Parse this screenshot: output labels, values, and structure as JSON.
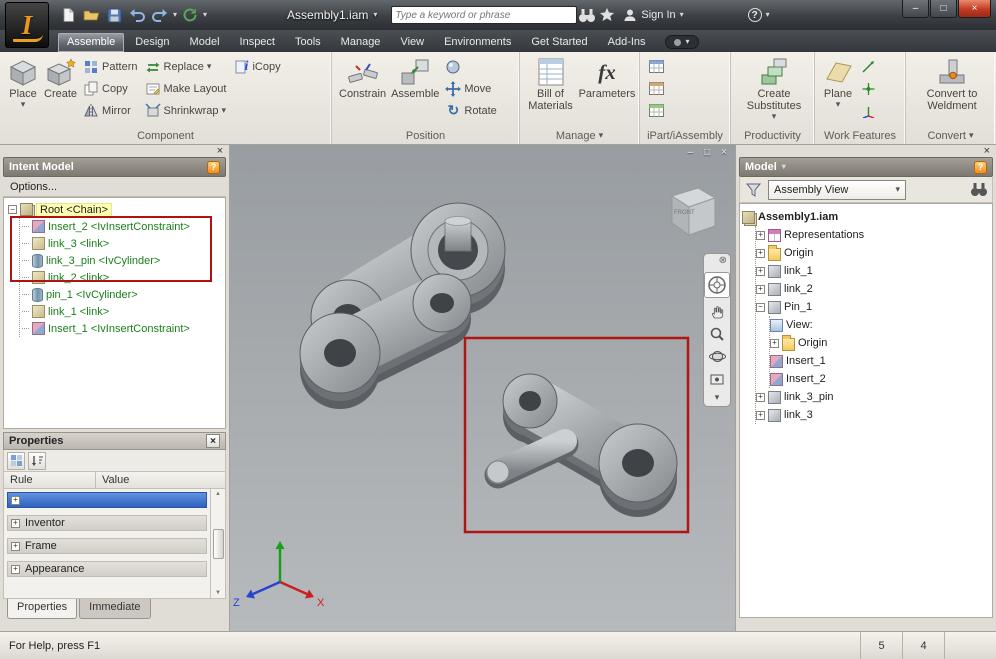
{
  "icons": {
    "dropdown": "▾",
    "close": "×",
    "minimize": "–",
    "maximize": "□",
    "help": "?",
    "plus": "+",
    "minus": "−",
    "up": "▲",
    "down": "▼",
    "rotate": "↻",
    "fx": "fx",
    "nav_close": "⊗",
    "logo": "I",
    "i_glyph": "i"
  },
  "titlebar": {
    "title": "Ass​embly1.iam",
    "search_placeholder": "Type a keyword or phrase",
    "sign_in": "Sign In"
  },
  "tabs": {
    "items": [
      {
        "label": "Assemble"
      },
      {
        "label": "Design"
      },
      {
        "label": "Model"
      },
      {
        "label": "Inspect"
      },
      {
        "label": "Tools"
      },
      {
        "label": "Manage"
      },
      {
        "label": "View"
      },
      {
        "label": "Environments"
      },
      {
        "label": "Get Started"
      },
      {
        "label": "Add-Ins"
      }
    ]
  },
  "ribbon": {
    "component": {
      "label": "Component",
      "place": "Place",
      "create": "Create",
      "pattern": "Pattern",
      "copy": "Copy",
      "mirror": "Mirror",
      "replace": "Replace",
      "make_layout": "Make Layout",
      "shrinkwrap": "Shrinkwrap",
      "icopy": "iCopy"
    },
    "position": {
      "label": "Position",
      "constrain": "Constrain",
      "assemble": "Assemble",
      "move": "Move",
      "rotate": "Rotate"
    },
    "manage": {
      "label": "Manage",
      "bom": "Bill of Materials",
      "parameters": "Parameters"
    },
    "ipart": {
      "label": "iPart/iAssembly"
    },
    "productivity": {
      "label": "Productivity",
      "create_substitutes": "Create Substitutes"
    },
    "work_features": {
      "label": "Work Features",
      "plane": "Plane"
    },
    "convert": {
      "label": "Convert",
      "convert_to_weldment": "Convert to Weldment"
    }
  },
  "intent_model": {
    "title": "Intent Model",
    "options": "Options...",
    "items": [
      {
        "label": "Root <Chain>"
      },
      {
        "label": "Insert_2 <IvInsertConstraint>"
      },
      {
        "label": "link_3 <link>"
      },
      {
        "label": "link_3_pin <IvCylinder>"
      },
      {
        "label": "link_2 <link>"
      },
      {
        "label": "pin_1 <IvCylinder>"
      },
      {
        "label": "link_1 <link>"
      },
      {
        "label": "Insert_1 <IvInsertConstraint>"
      }
    ]
  },
  "properties": {
    "title": "Properties",
    "col_rule": "Rule",
    "col_value": "Value",
    "rows": [
      {
        "label": "Inventor"
      },
      {
        "label": "Frame"
      },
      {
        "label": "Appearance"
      }
    ],
    "tab_properties": "Properties",
    "tab_immediate": "Immediate"
  },
  "viewport": {
    "viewcube_front": "FRONT",
    "axis_x": "X",
    "axis_z": "Z"
  },
  "model_browser": {
    "title": "Model",
    "view_mode": "Assembly View",
    "items": [
      {
        "label": "Assembly1.iam"
      },
      {
        "label": "Representations"
      },
      {
        "label": "Origin"
      },
      {
        "label": "link_1"
      },
      {
        "label": "link_2"
      },
      {
        "label": "Pin_1"
      },
      {
        "label": "View:"
      },
      {
        "label": "Origin"
      },
      {
        "label": "Insert_1"
      },
      {
        "label": "Insert_2"
      },
      {
        "label": "link_3_pin"
      },
      {
        "label": "link_3"
      }
    ]
  },
  "statusbar": {
    "help": "For Help, press F1",
    "n1": "5",
    "n2": "4"
  }
}
